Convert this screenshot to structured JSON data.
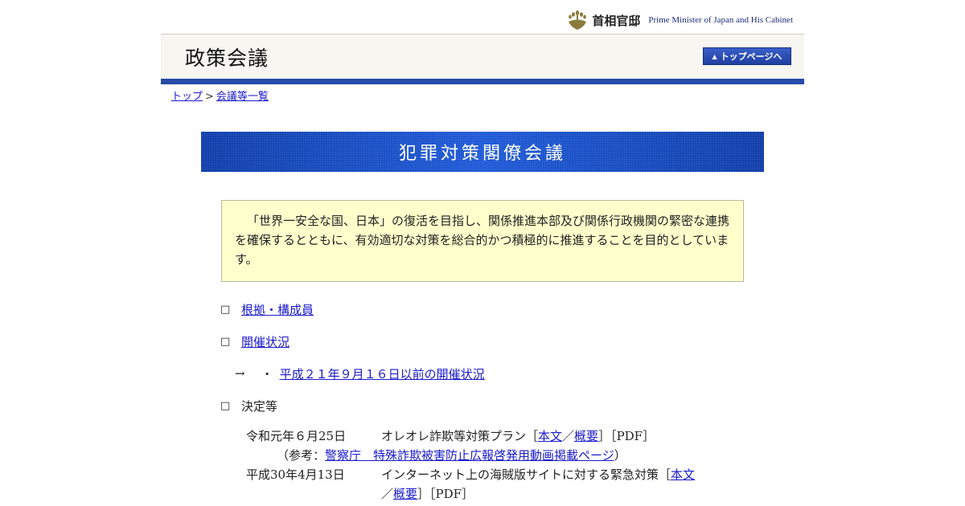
{
  "site": {
    "brand_ja": "首相官邸",
    "brand_en": "Prime Minister of Japan and His Cabinet",
    "header_title": "政策会議",
    "top_button": "トップページへ"
  },
  "breadcrumb": {
    "top": "トップ",
    "separator": ">",
    "meetings": "会議等一覧"
  },
  "banner": {
    "title": "犯罪対策閣僚会議"
  },
  "intro": {
    "text": "「世界一安全な国、日本」の復活を目指し、関係推進本部及び関係行政機関の緊密な連携を確保するとともに、有効適切な対策を総合的かつ積極的に推進することを目的としています。"
  },
  "menu": {
    "bullet": "□",
    "basis": "根拠・構成員",
    "status": "開催状況",
    "arrow": "→",
    "dot": "・",
    "past_status": "平成２１年９月１６日以前の開催状況",
    "decisions": "決定等"
  },
  "decisions": [
    {
      "date": "令和元年６月25日",
      "title": "オレオレ詐欺等対策プラン［",
      "link1": "本文",
      "slash": "／",
      "link2": "概要",
      "tail": "］［PDF］"
    },
    {
      "ref_open": "（参考：",
      "ref_link": "警察庁　特殊詐欺被害防止広報啓発用動画掲載ページ",
      "ref_close": "）"
    },
    {
      "date": "平成30年4月13日",
      "title": "インターネット上の海賊版サイトに対する緊急対策［",
      "link1": "本文",
      "slash": "／",
      "link2": "概要",
      "tail": "］［PDF］"
    }
  ]
}
